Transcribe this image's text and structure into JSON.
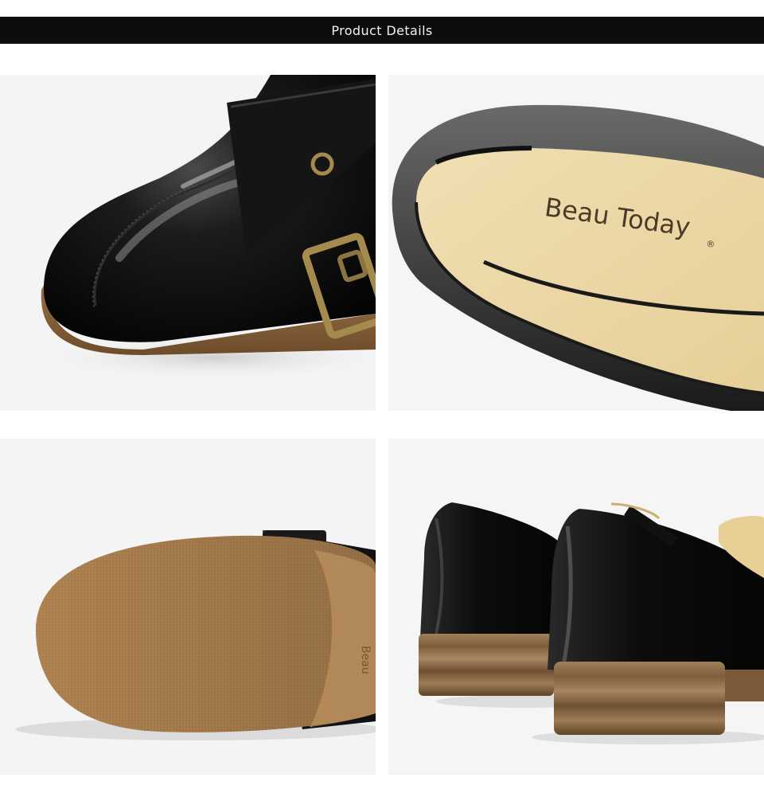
{
  "header": {
    "title": "Product Details"
  },
  "panels": {
    "toe_closeup": {
      "subject": "toe-buckle-closeup"
    },
    "insole_closeup": {
      "brand_label": "Beau Today",
      "registered_mark": "®",
      "subject": "insole-brand-closeup"
    },
    "sole_view": {
      "subject": "outsole-view",
      "sole_imprint": "Beau"
    },
    "heel_view": {
      "subject": "heel-pair-view"
    }
  },
  "colors": {
    "header_bg": "#0d0d0d",
    "header_text": "#f2f2f2",
    "leather": "#111111",
    "insole": "#ecd9a8",
    "sole": "#b98b57",
    "heel_wood": "#8c6a44",
    "buckle_metal": "#a48a4c"
  }
}
